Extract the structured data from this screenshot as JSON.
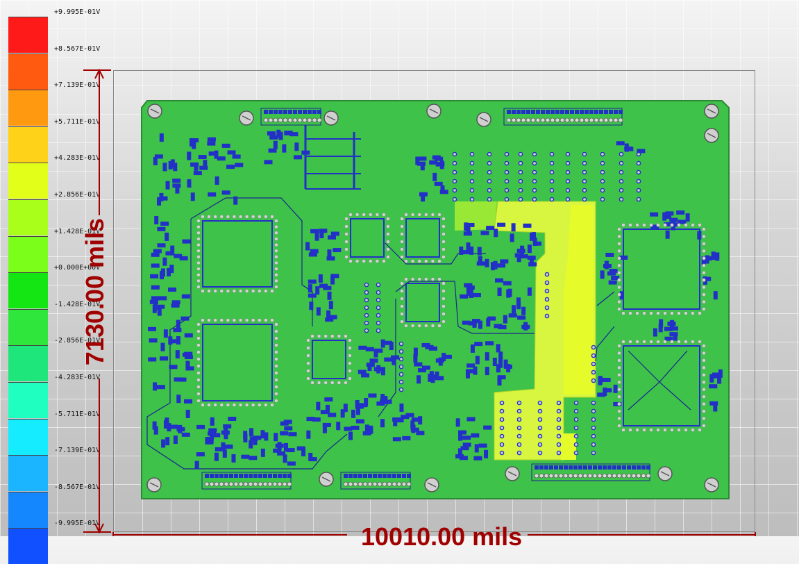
{
  "legend": {
    "title": "",
    "labels": [
      "+9.995E-01V",
      "+8.567E-01V",
      "+7.139E-01V",
      "+5.711E-01V",
      "+4.283E-01V",
      "+2.856E-01V",
      "+1.428E-01V",
      "+0.000E+00V",
      "-1.428E-01V",
      "-2.856E-01V",
      "-4.283E-01V",
      "-5.711E-01V",
      "-7.139E-01V",
      "-8.567E-01V",
      "-9.995E-01V"
    ],
    "colors": [
      "#ff1a1a",
      "#ff5a10",
      "#ff9a10",
      "#ffd21a",
      "#e2ff1a",
      "#aaff1a",
      "#7bff1a",
      "#14e614",
      "#2ee63c",
      "#1fe67a",
      "#1fffc0",
      "#16ecff",
      "#1ab4ff",
      "#1487ff",
      "#1050ff"
    ]
  },
  "dimensions": {
    "vertical": "7130.00 mils",
    "horizontal": "10010.00 mils"
  },
  "board": {
    "base_color": "#3ec24a",
    "high_region_color": "#c8f52a",
    "mid_region_color": "#9ae836",
    "trace_color": "#2230c8",
    "arrow_color": "#a00000"
  }
}
